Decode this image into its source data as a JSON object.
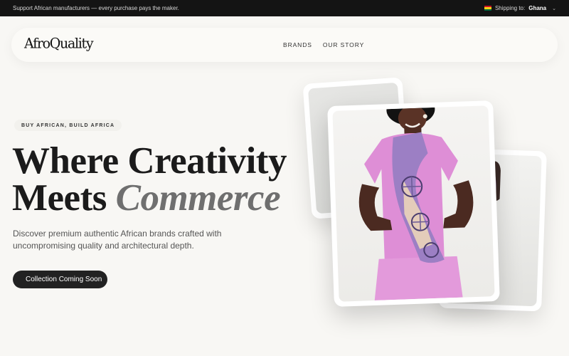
{
  "topbar": {
    "message": "Support African manufacturers — every purchase pays the maker.",
    "shipping_label": "Shipping to:",
    "shipping_country": "Ghana",
    "chevron_icon": "chevron-down-icon"
  },
  "header": {
    "logo": "AfroQuality",
    "nav": [
      "BRANDS",
      "OUR STORY"
    ]
  },
  "hero": {
    "eyebrow": "BUY AFRICAN, BUILD AFRICA",
    "headline_line1": "Where Creativity",
    "headline_line2_plain": "Meets",
    "headline_line2_accent": "Commerce",
    "subtitle": "Discover premium authentic African brands crafted with uncompromising quality and architectural depth.",
    "cta": "Collection Coming Soon"
  },
  "colors": {
    "background": "#f8f7f4",
    "topbar": "#141414",
    "cta": "#222222",
    "outfit": "#de8ed6",
    "scarf": "#9c7fc4"
  }
}
